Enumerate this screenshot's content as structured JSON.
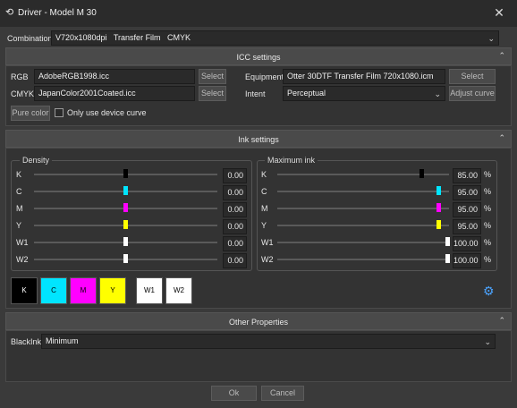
{
  "window": {
    "title": "Driver - Model M 30",
    "close_glyph": "✕"
  },
  "combination": {
    "label": "Combination",
    "value": "V720x1080dpi   Transfer Film   CMYK"
  },
  "icc": {
    "header": "ICC settings",
    "rgb_label": "RGB",
    "rgb_value": "AdobeRGB1998.icc",
    "rgb_select": "Select",
    "cmyk_label": "CMYK",
    "cmyk_value": "JapanColor2001Coated.icc",
    "cmyk_select": "Select",
    "equipment_label": "Equipment",
    "equipment_value": "Otter 30DTF Transfer Film 720x1080.icm",
    "equipment_select": "Select",
    "intent_label": "Intent",
    "intent_value": "Perceptual",
    "adjust_curve": "Adjust curve",
    "pure_color": "Pure color",
    "only_device_curve": "Only use device curve"
  },
  "ink": {
    "header": "Ink settings",
    "density_title": "Density",
    "max_title": "Maximum ink",
    "percent": "%",
    "channels": [
      {
        "name": "K",
        "color": "#000000",
        "density": "0.00",
        "density_frac": 0.5,
        "max": "85.00",
        "max_frac": 0.85
      },
      {
        "name": "C",
        "color": "#00e5ff",
        "density": "0.00",
        "density_frac": 0.5,
        "max": "95.00",
        "max_frac": 0.95
      },
      {
        "name": "M",
        "color": "#ff00ff",
        "density": "0.00",
        "density_frac": 0.5,
        "max": "95.00",
        "max_frac": 0.95
      },
      {
        "name": "Y",
        "color": "#ffff00",
        "density": "0.00",
        "density_frac": 0.5,
        "max": "95.00",
        "max_frac": 0.95
      },
      {
        "name": "W1",
        "color": "#ffffff",
        "density": "0.00",
        "density_frac": 0.5,
        "max": "100.00",
        "max_frac": 1.0
      },
      {
        "name": "W2",
        "color": "#ffffff",
        "density": "0.00",
        "density_frac": 0.5,
        "max": "100.00",
        "max_frac": 1.0
      }
    ],
    "swatches": [
      "K",
      "C",
      "M",
      "Y",
      "W1",
      "W2"
    ]
  },
  "other": {
    "header": "Other Properties",
    "blackink_label": "BlackInk",
    "blackink_value": "Minimum"
  },
  "footer": {
    "ok": "Ok",
    "cancel": "Cancel"
  }
}
